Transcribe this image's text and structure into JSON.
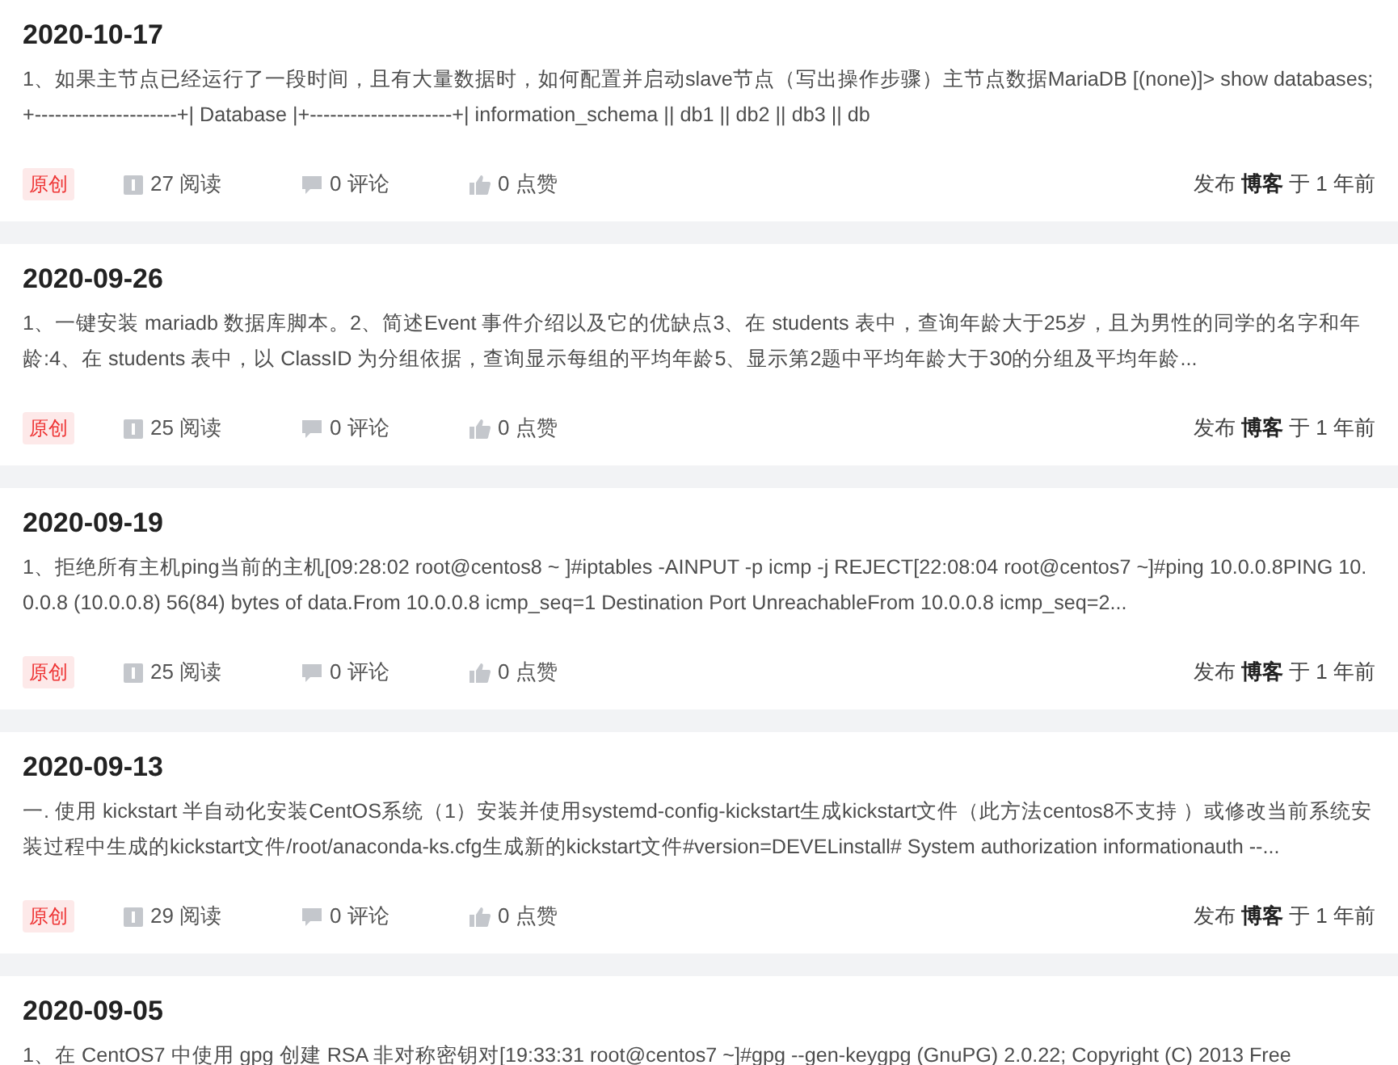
{
  "posts": [
    {
      "date": "2020-10-17",
      "summary": "1、如果主节点已经运行了一段时间，且有大量数据时，如何配置并启动slave节点（写出操作步骤）主节点数据MariaDB [(none)]> show databases;+---------------------+| Database |+---------------------+| information_schema || db1 || db2 || db3 || db",
      "badge": "原创",
      "reads": "27 阅读",
      "comments": "0 评论",
      "likes": "0 点赞",
      "published": "发布 **博客** 于 1 年前"
    },
    {
      "date": "2020-09-26",
      "summary": "1、一键安装 mariadb 数据库脚本。2、简述Event 事件介绍以及它的优缺点3、在 students 表中，查询年龄大于25岁，且为男性的同学的名字和年龄:4、在 students 表中，以 ClassID 为分组依据，查询显示每组的平均年龄5、显示第2题中平均年龄大于30的分组及平均年龄...",
      "badge": "原创",
      "reads": "25 阅读",
      "comments": "0 评论",
      "likes": "0 点赞",
      "published": "发布 **博客** 于 1 年前"
    },
    {
      "date": "2020-09-19",
      "summary": "1、拒绝所有主机ping当前的主机[09:28:02 root@centos8 ~ ]#iptables -AINPUT -p icmp -j REJECT[22:08:04 root@centos7 ~]#ping 10.0.0.8PING 10.0.0.8 (10.0.0.8) 56(84) bytes of data.From 10.0.0.8 icmp_seq=1 Destination Port UnreachableFrom 10.0.0.8 icmp_seq=2...",
      "badge": "原创",
      "reads": "25 阅读",
      "comments": "0 评论",
      "likes": "0 点赞",
      "published": "发布 **博客** 于 1 年前"
    },
    {
      "date": "2020-09-13",
      "summary": "一. 使用 kickstart 半自动化安装CentOS系统（1）安装并使用systemd-config-kickstart生成kickstart文件（此方法centos8不支持 ）或修改当前系统安装过程中生成的kickstart文件/root/anaconda-ks.cfg生成新的kickstart文件#version=DEVELinstall# System authorization informationauth --...",
      "badge": "原创",
      "reads": "29 阅读",
      "comments": "0 评论",
      "likes": "0 点赞",
      "published": "发布 **博客** 于 1 年前"
    },
    {
      "date": "2020-09-05",
      "summary": "1、在 CentOS7 中使用 gpg 创建 RSA 非对称密钥对[19:33:31 root@centos7 ~]#gpg --gen-keygpg (GnuPG) 2.0.22; Copyright (C) 2013 Free"
    }
  ]
}
